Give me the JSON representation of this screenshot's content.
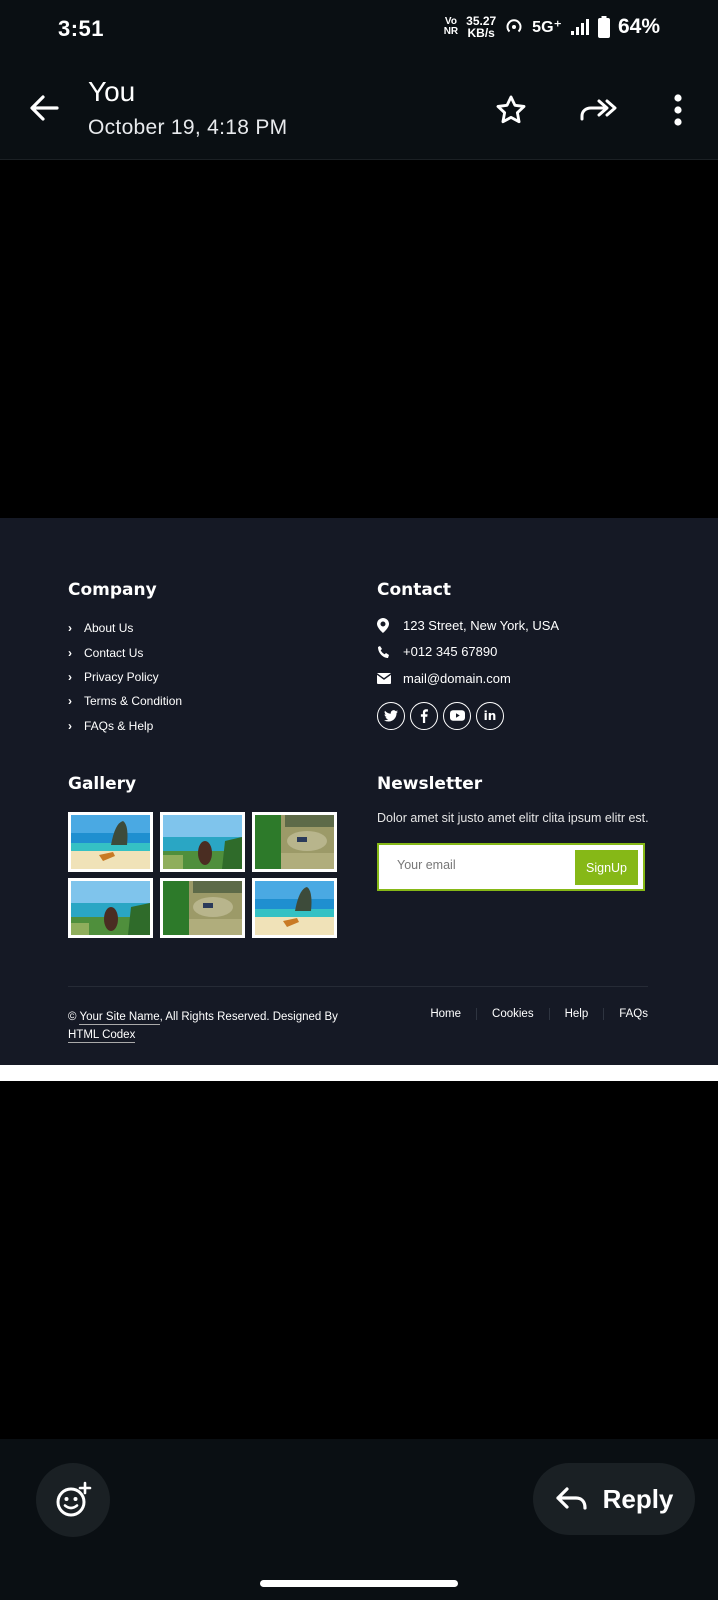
{
  "status_bar": {
    "time": "3:51",
    "vonr_top": "Vo",
    "vonr_bottom": "NR",
    "speed_value": "35.27",
    "speed_unit": "KB/s",
    "network": "5G⁺",
    "battery_percent": "64%"
  },
  "header": {
    "sender": "You",
    "date": "October 19, 4:18 PM"
  },
  "footer": {
    "company": {
      "heading": "Company",
      "links": [
        "About Us",
        "Contact Us",
        "Privacy Policy",
        "Terms & Condition",
        "FAQs & Help"
      ]
    },
    "contact": {
      "heading": "Contact",
      "address": "123 Street, New York, USA",
      "phone": "+012 345 67890",
      "email": "mail@domain.com",
      "socials": [
        "twitter-icon",
        "facebook-icon",
        "youtube-icon",
        "linkedin-icon"
      ]
    },
    "gallery": {
      "heading": "Gallery"
    },
    "newsletter": {
      "heading": "Newsletter",
      "text": "Dolor amet sit justo amet elitr clita ipsum elitr est.",
      "placeholder": "Your email",
      "button": "SignUp"
    },
    "copyright": {
      "prefix": "© ",
      "site_name": "Your Site Name",
      "middle": ", All Rights Reserved. Designed By ",
      "designer": "HTML Codex"
    },
    "nav": [
      "Home",
      "Cookies",
      "Help",
      "FAQs"
    ]
  },
  "bottom_bar": {
    "reply_label": "Reply"
  },
  "colors": {
    "footer_bg": "#151925",
    "accent_green": "#86b817",
    "app_bg": "#0a0f13"
  }
}
